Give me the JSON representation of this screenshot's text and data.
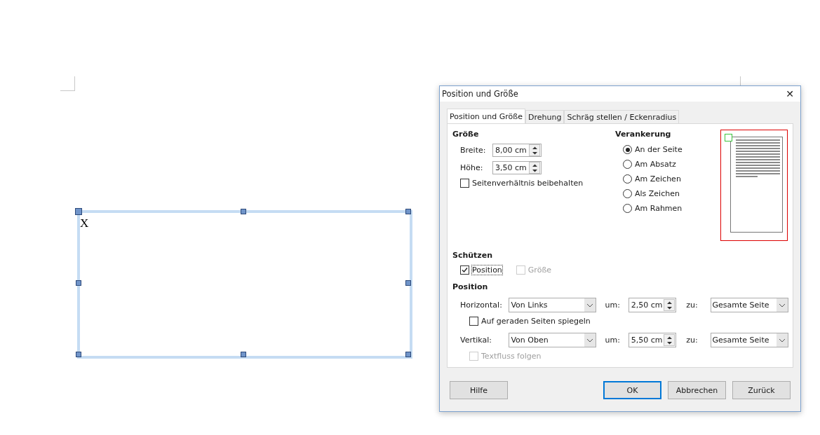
{
  "document": {
    "frame_text": "X"
  },
  "dialog": {
    "title": "Position und Größe",
    "close": "✕",
    "tabs": [
      {
        "label": "Position und Größe",
        "selected": true
      },
      {
        "label": "Drehung",
        "selected": false
      },
      {
        "label": "Schräg stellen / Eckenradius",
        "selected": false
      }
    ],
    "size": {
      "heading": "Größe",
      "fields": [
        {
          "label": "Breite:",
          "value": "8,00 cm"
        },
        {
          "label": "Höhe:",
          "value": "3,50 cm"
        }
      ],
      "keep_ratio": {
        "label": "Seitenverhältnis beibehalten",
        "checked": false
      }
    },
    "anchor": {
      "heading": "Verankerung",
      "options": [
        {
          "label": "An der Seite",
          "selected": true
        },
        {
          "label": "Am Absatz",
          "selected": false
        },
        {
          "label": "Am Zeichen",
          "selected": false
        },
        {
          "label": "Als Zeichen",
          "selected": false
        },
        {
          "label": "Am Rahmen",
          "selected": false
        }
      ]
    },
    "protect": {
      "heading": "Schützen",
      "items": [
        {
          "label": "Position",
          "checked": true,
          "disabled": false
        },
        {
          "label": "Größe",
          "checked": false,
          "disabled": true
        }
      ]
    },
    "position": {
      "heading": "Position",
      "items": [
        {
          "kind": "row",
          "label": "Horizontal:",
          "select": "Von Links",
          "um_label": "um:",
          "value": "2,50 cm",
          "zu_label": "zu:",
          "target": "Gesamte Seite"
        },
        {
          "kind": "check",
          "label": "Auf geraden Seiten spiegeln",
          "checked": false,
          "disabled": false
        },
        {
          "kind": "row",
          "label": "Vertikal:",
          "select": "Von Oben",
          "um_label": "um:",
          "value": "5,50 cm",
          "zu_label": "zu:",
          "target": "Gesamte Seite"
        },
        {
          "kind": "check",
          "label": "Textfluss folgen",
          "checked": false,
          "disabled": true
        }
      ]
    },
    "buttons": [
      {
        "label": "Hilfe",
        "kind": "help"
      },
      {
        "label": "OK",
        "kind": "default"
      },
      {
        "label": "Abbrechen",
        "kind": "normal"
      },
      {
        "label": "Zurück",
        "kind": "normal"
      }
    ]
  }
}
